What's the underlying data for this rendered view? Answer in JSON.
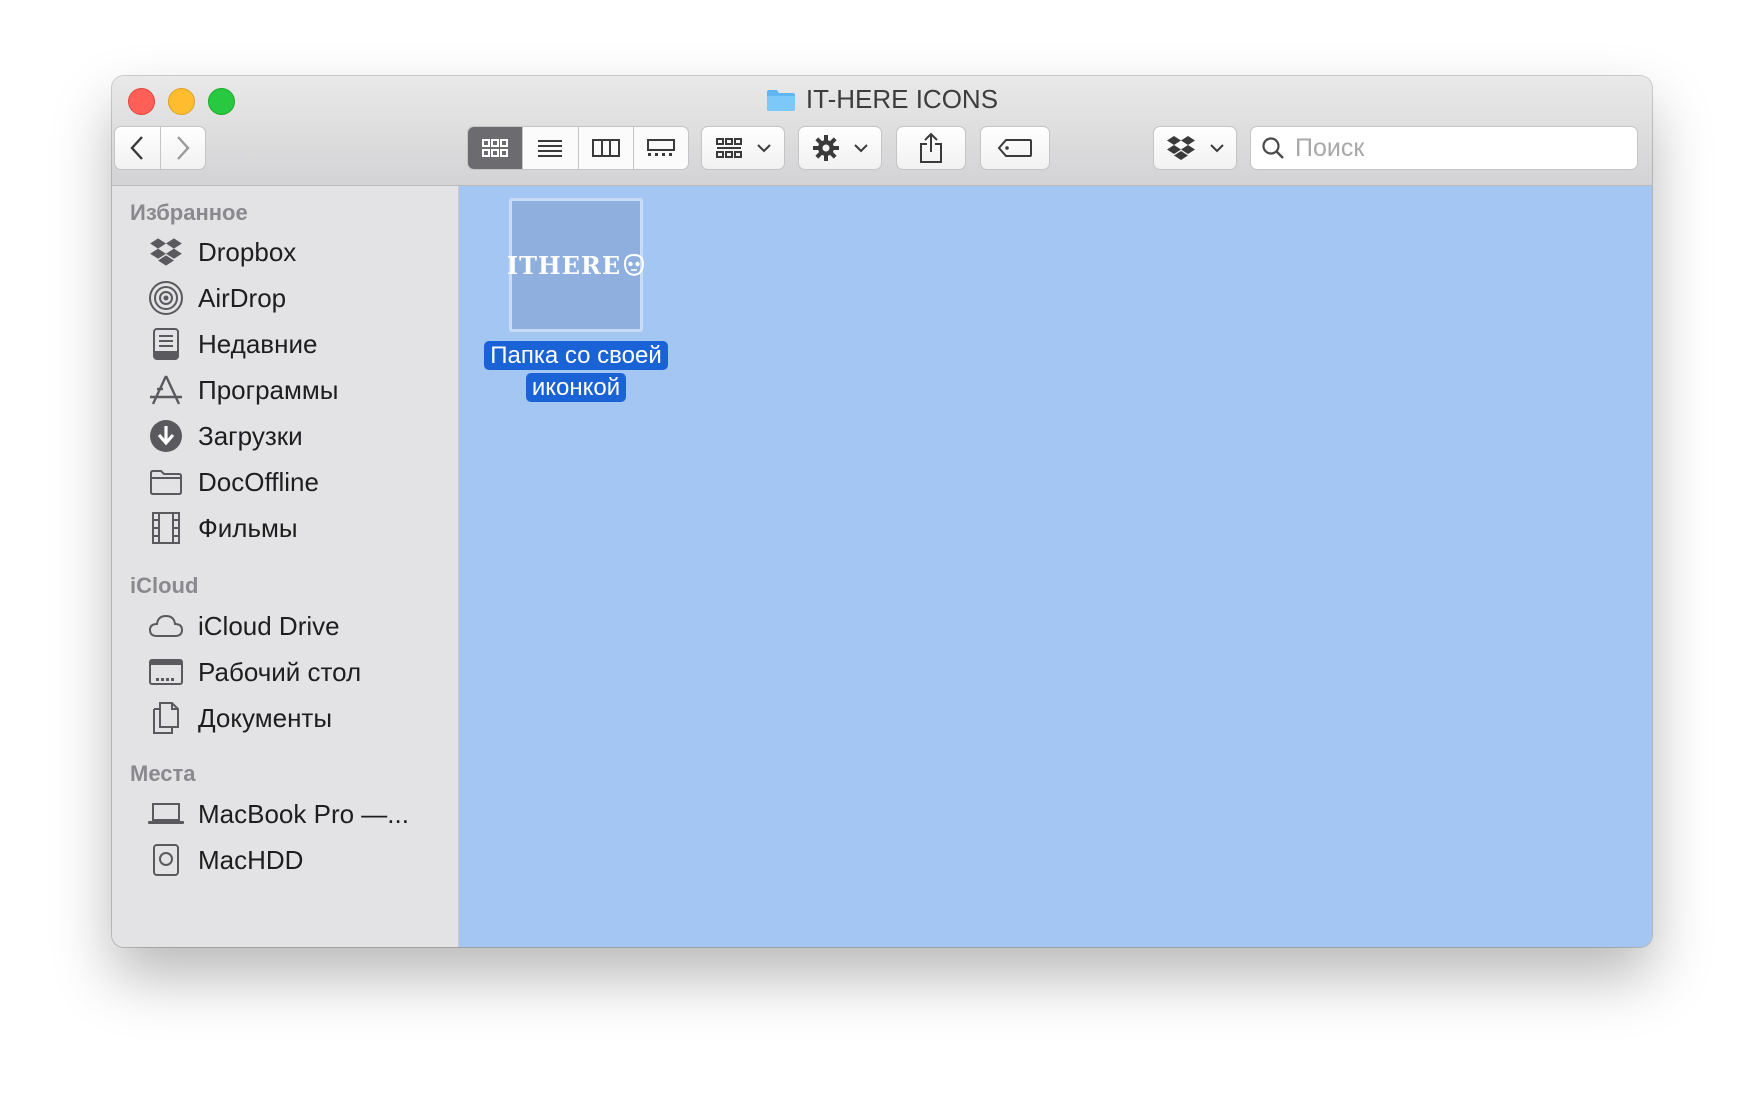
{
  "window": {
    "title": "IT-HERE ICONS"
  },
  "toolbar": {
    "back_icon": "chevron-left-icon",
    "forward_icon": "chevron-right-icon",
    "view_modes": [
      "icon-view-icon",
      "list-view-icon",
      "column-view-icon",
      "gallery-view-icon"
    ],
    "active_view": 0,
    "search_placeholder": "Поиск"
  },
  "sidebar": {
    "favorites_header": "Избранное",
    "favorites": [
      {
        "label": "Dropbox",
        "icon": "dropbox-icon"
      },
      {
        "label": "AirDrop",
        "icon": "airdrop-icon"
      },
      {
        "label": "Недавние",
        "icon": "recents-icon"
      },
      {
        "label": "Программы",
        "icon": "applications-icon"
      },
      {
        "label": "Загрузки",
        "icon": "downloads-icon"
      },
      {
        "label": "DocOffline",
        "icon": "folder-icon"
      },
      {
        "label": "Фильмы",
        "icon": "movies-icon"
      }
    ],
    "icloud_header": "iCloud",
    "icloud": [
      {
        "label": "iCloud Drive",
        "icon": "cloud-icon"
      },
      {
        "label": "Рабочий стол",
        "icon": "desktop-icon"
      },
      {
        "label": "Документы",
        "icon": "documents-icon"
      }
    ],
    "places_header": "Места",
    "places": [
      {
        "label": "MacBook Pro —...",
        "icon": "laptop-icon"
      },
      {
        "label": "MacHDD",
        "icon": "disk-icon"
      }
    ]
  },
  "content": {
    "item": {
      "logo_text": "ITHERE",
      "name_line1": "Папка со своей",
      "name_line2": "иконкой"
    }
  },
  "colors": {
    "selection": "#1a63d6",
    "content_bg": "#a4c6f3",
    "sidebar_bg": "#e3e3e5"
  }
}
